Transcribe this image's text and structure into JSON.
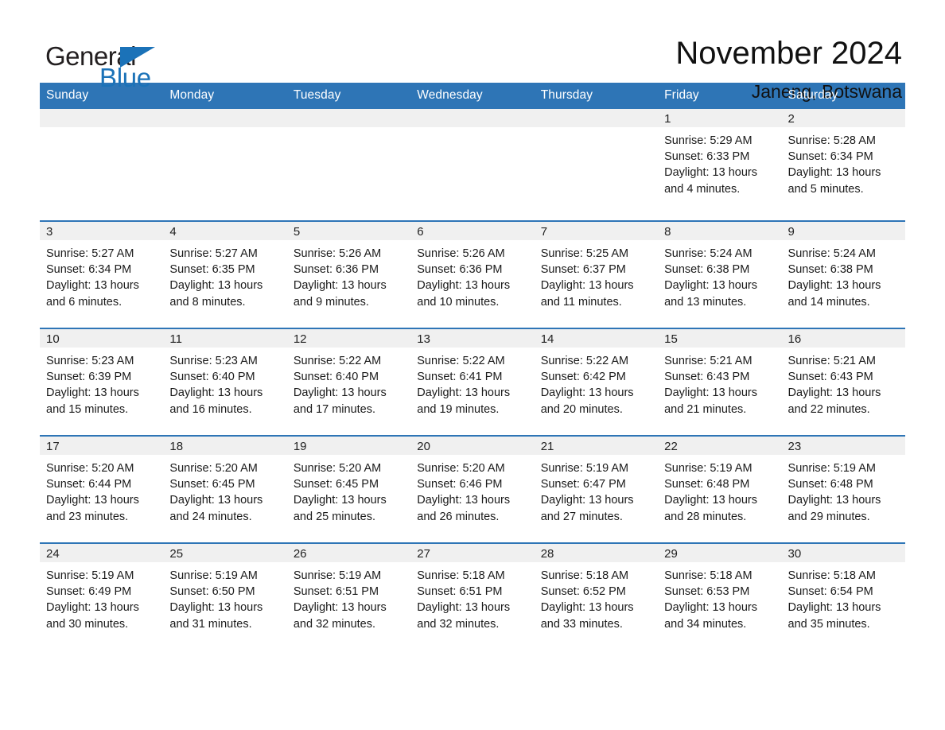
{
  "brand": {
    "name_part1": "General",
    "name_part2": "Blue",
    "accent_color": "#1b72b8",
    "logo_icon": "triangle-flag-icon"
  },
  "header": {
    "title": "November 2024",
    "location": "Janeng, Botswana"
  },
  "calendar": {
    "header_color": "#2e75b6",
    "daynum_band_color": "#f0f0f0",
    "weekday_headers": [
      "Sunday",
      "Monday",
      "Tuesday",
      "Wednesday",
      "Thursday",
      "Friday",
      "Saturday"
    ],
    "weeks": [
      [
        {
          "day": "",
          "sunrise": "",
          "sunset": "",
          "daylight_line1": "",
          "daylight_line2": ""
        },
        {
          "day": "",
          "sunrise": "",
          "sunset": "",
          "daylight_line1": "",
          "daylight_line2": ""
        },
        {
          "day": "",
          "sunrise": "",
          "sunset": "",
          "daylight_line1": "",
          "daylight_line2": ""
        },
        {
          "day": "",
          "sunrise": "",
          "sunset": "",
          "daylight_line1": "",
          "daylight_line2": ""
        },
        {
          "day": "",
          "sunrise": "",
          "sunset": "",
          "daylight_line1": "",
          "daylight_line2": ""
        },
        {
          "day": "1",
          "sunrise": "Sunrise: 5:29 AM",
          "sunset": "Sunset: 6:33 PM",
          "daylight_line1": "Daylight: 13 hours",
          "daylight_line2": "and 4 minutes."
        },
        {
          "day": "2",
          "sunrise": "Sunrise: 5:28 AM",
          "sunset": "Sunset: 6:34 PM",
          "daylight_line1": "Daylight: 13 hours",
          "daylight_line2": "and 5 minutes."
        }
      ],
      [
        {
          "day": "3",
          "sunrise": "Sunrise: 5:27 AM",
          "sunset": "Sunset: 6:34 PM",
          "daylight_line1": "Daylight: 13 hours",
          "daylight_line2": "and 6 minutes."
        },
        {
          "day": "4",
          "sunrise": "Sunrise: 5:27 AM",
          "sunset": "Sunset: 6:35 PM",
          "daylight_line1": "Daylight: 13 hours",
          "daylight_line2": "and 8 minutes."
        },
        {
          "day": "5",
          "sunrise": "Sunrise: 5:26 AM",
          "sunset": "Sunset: 6:36 PM",
          "daylight_line1": "Daylight: 13 hours",
          "daylight_line2": "and 9 minutes."
        },
        {
          "day": "6",
          "sunrise": "Sunrise: 5:26 AM",
          "sunset": "Sunset: 6:36 PM",
          "daylight_line1": "Daylight: 13 hours",
          "daylight_line2": "and 10 minutes."
        },
        {
          "day": "7",
          "sunrise": "Sunrise: 5:25 AM",
          "sunset": "Sunset: 6:37 PM",
          "daylight_line1": "Daylight: 13 hours",
          "daylight_line2": "and 11 minutes."
        },
        {
          "day": "8",
          "sunrise": "Sunrise: 5:24 AM",
          "sunset": "Sunset: 6:38 PM",
          "daylight_line1": "Daylight: 13 hours",
          "daylight_line2": "and 13 minutes."
        },
        {
          "day": "9",
          "sunrise": "Sunrise: 5:24 AM",
          "sunset": "Sunset: 6:38 PM",
          "daylight_line1": "Daylight: 13 hours",
          "daylight_line2": "and 14 minutes."
        }
      ],
      [
        {
          "day": "10",
          "sunrise": "Sunrise: 5:23 AM",
          "sunset": "Sunset: 6:39 PM",
          "daylight_line1": "Daylight: 13 hours",
          "daylight_line2": "and 15 minutes."
        },
        {
          "day": "11",
          "sunrise": "Sunrise: 5:23 AM",
          "sunset": "Sunset: 6:40 PM",
          "daylight_line1": "Daylight: 13 hours",
          "daylight_line2": "and 16 minutes."
        },
        {
          "day": "12",
          "sunrise": "Sunrise: 5:22 AM",
          "sunset": "Sunset: 6:40 PM",
          "daylight_line1": "Daylight: 13 hours",
          "daylight_line2": "and 17 minutes."
        },
        {
          "day": "13",
          "sunrise": "Sunrise: 5:22 AM",
          "sunset": "Sunset: 6:41 PM",
          "daylight_line1": "Daylight: 13 hours",
          "daylight_line2": "and 19 minutes."
        },
        {
          "day": "14",
          "sunrise": "Sunrise: 5:22 AM",
          "sunset": "Sunset: 6:42 PM",
          "daylight_line1": "Daylight: 13 hours",
          "daylight_line2": "and 20 minutes."
        },
        {
          "day": "15",
          "sunrise": "Sunrise: 5:21 AM",
          "sunset": "Sunset: 6:43 PM",
          "daylight_line1": "Daylight: 13 hours",
          "daylight_line2": "and 21 minutes."
        },
        {
          "day": "16",
          "sunrise": "Sunrise: 5:21 AM",
          "sunset": "Sunset: 6:43 PM",
          "daylight_line1": "Daylight: 13 hours",
          "daylight_line2": "and 22 minutes."
        }
      ],
      [
        {
          "day": "17",
          "sunrise": "Sunrise: 5:20 AM",
          "sunset": "Sunset: 6:44 PM",
          "daylight_line1": "Daylight: 13 hours",
          "daylight_line2": "and 23 minutes."
        },
        {
          "day": "18",
          "sunrise": "Sunrise: 5:20 AM",
          "sunset": "Sunset: 6:45 PM",
          "daylight_line1": "Daylight: 13 hours",
          "daylight_line2": "and 24 minutes."
        },
        {
          "day": "19",
          "sunrise": "Sunrise: 5:20 AM",
          "sunset": "Sunset: 6:45 PM",
          "daylight_line1": "Daylight: 13 hours",
          "daylight_line2": "and 25 minutes."
        },
        {
          "day": "20",
          "sunrise": "Sunrise: 5:20 AM",
          "sunset": "Sunset: 6:46 PM",
          "daylight_line1": "Daylight: 13 hours",
          "daylight_line2": "and 26 minutes."
        },
        {
          "day": "21",
          "sunrise": "Sunrise: 5:19 AM",
          "sunset": "Sunset: 6:47 PM",
          "daylight_line1": "Daylight: 13 hours",
          "daylight_line2": "and 27 minutes."
        },
        {
          "day": "22",
          "sunrise": "Sunrise: 5:19 AM",
          "sunset": "Sunset: 6:48 PM",
          "daylight_line1": "Daylight: 13 hours",
          "daylight_line2": "and 28 minutes."
        },
        {
          "day": "23",
          "sunrise": "Sunrise: 5:19 AM",
          "sunset": "Sunset: 6:48 PM",
          "daylight_line1": "Daylight: 13 hours",
          "daylight_line2": "and 29 minutes."
        }
      ],
      [
        {
          "day": "24",
          "sunrise": "Sunrise: 5:19 AM",
          "sunset": "Sunset: 6:49 PM",
          "daylight_line1": "Daylight: 13 hours",
          "daylight_line2": "and 30 minutes."
        },
        {
          "day": "25",
          "sunrise": "Sunrise: 5:19 AM",
          "sunset": "Sunset: 6:50 PM",
          "daylight_line1": "Daylight: 13 hours",
          "daylight_line2": "and 31 minutes."
        },
        {
          "day": "26",
          "sunrise": "Sunrise: 5:19 AM",
          "sunset": "Sunset: 6:51 PM",
          "daylight_line1": "Daylight: 13 hours",
          "daylight_line2": "and 32 minutes."
        },
        {
          "day": "27",
          "sunrise": "Sunrise: 5:18 AM",
          "sunset": "Sunset: 6:51 PM",
          "daylight_line1": "Daylight: 13 hours",
          "daylight_line2": "and 32 minutes."
        },
        {
          "day": "28",
          "sunrise": "Sunrise: 5:18 AM",
          "sunset": "Sunset: 6:52 PM",
          "daylight_line1": "Daylight: 13 hours",
          "daylight_line2": "and 33 minutes."
        },
        {
          "day": "29",
          "sunrise": "Sunrise: 5:18 AM",
          "sunset": "Sunset: 6:53 PM",
          "daylight_line1": "Daylight: 13 hours",
          "daylight_line2": "and 34 minutes."
        },
        {
          "day": "30",
          "sunrise": "Sunrise: 5:18 AM",
          "sunset": "Sunset: 6:54 PM",
          "daylight_line1": "Daylight: 13 hours",
          "daylight_line2": "and 35 minutes."
        }
      ]
    ]
  }
}
